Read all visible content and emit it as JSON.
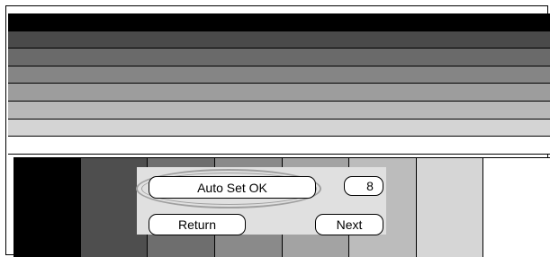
{
  "pattern": {
    "horizontal_bars": [
      "#000000",
      "#4a4a4a",
      "#6a6a6a",
      "#858585",
      "#9d9d9d",
      "#b8b8b8",
      "#d4d4d4",
      "#ffffff"
    ],
    "vertical_bars": [
      "#000000",
      "#4e4e4e",
      "#6e6e6e",
      "#8a8a8a",
      "#a3a3a3",
      "#bcbcbc",
      "#d6d6d6",
      "#ffffff"
    ]
  },
  "dialog": {
    "status_label": "Auto Set OK",
    "value": "8",
    "return_label": "Return",
    "next_label": "Next"
  }
}
